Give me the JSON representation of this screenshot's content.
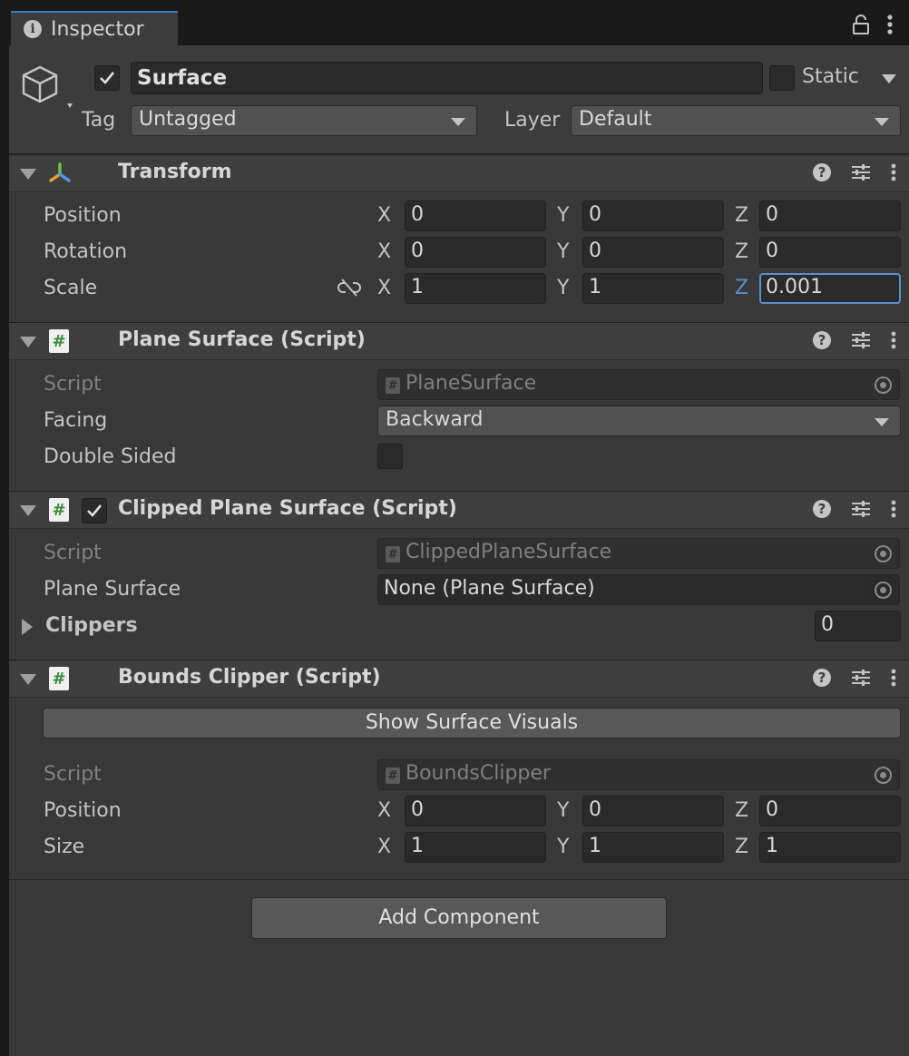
{
  "tab": {
    "title": "Inspector",
    "icons": [
      "info-icon",
      "lock-icon",
      "kebab-menu-icon"
    ]
  },
  "gameobject": {
    "name": "Surface",
    "active": true,
    "static_label": "Static",
    "static": false,
    "tag_label": "Tag",
    "tag_value": "Untagged",
    "layer_label": "Layer",
    "layer_value": "Default"
  },
  "transform": {
    "title": "Transform",
    "rows": [
      {
        "label": "Position",
        "x": "0",
        "y": "0",
        "z": "0"
      },
      {
        "label": "Rotation",
        "x": "0",
        "y": "0",
        "z": "0"
      },
      {
        "label": "Scale",
        "x": "1",
        "y": "1",
        "z": "0.001"
      }
    ],
    "axes": {
      "x": "X",
      "y": "Y",
      "z": "Z"
    }
  },
  "plane_surface": {
    "title": "Plane Surface (Script)",
    "script_label": "Script",
    "script_value": "PlaneSurface",
    "facing_label": "Facing",
    "facing_value": "Backward",
    "double_sided_label": "Double Sided",
    "double_sided": false
  },
  "clipped_plane_surface": {
    "title": "Clipped Plane Surface (Script)",
    "enabled": true,
    "script_label": "Script",
    "script_value": "ClippedPlaneSurface",
    "plane_surface_label": "Plane Surface",
    "plane_surface_value": "None (Plane Surface)",
    "clippers_label": "Clippers",
    "clippers_count": "0"
  },
  "bounds_clipper": {
    "title": "Bounds Clipper (Script)",
    "show_visuals_button": "Show Surface Visuals",
    "script_label": "Script",
    "script_value": "BoundsClipper",
    "rows": [
      {
        "label": "Position",
        "x": "0",
        "y": "0",
        "z": "0"
      },
      {
        "label": "Size",
        "x": "1",
        "y": "1",
        "z": "1"
      }
    ]
  },
  "add_component_button": "Add Component",
  "colors": {
    "accent": "#5a8fd0",
    "panel": "#383838",
    "header": "#3e3e3e",
    "field": "#2a2a2a"
  }
}
